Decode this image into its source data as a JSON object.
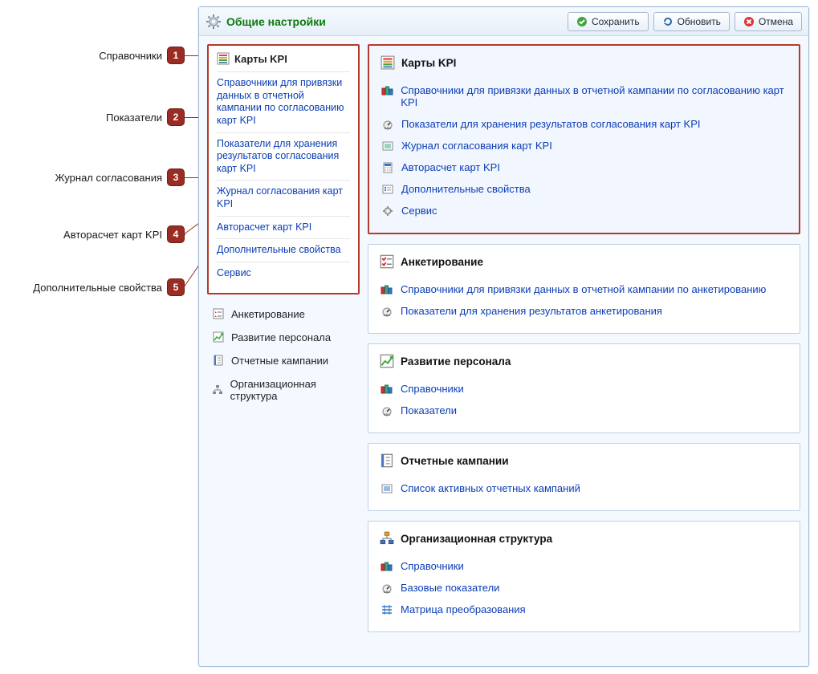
{
  "annotations": [
    {
      "label": "Справочники",
      "num": "1"
    },
    {
      "label": "Показатели",
      "num": "2"
    },
    {
      "label": "Журнал согласования",
      "num": "3"
    },
    {
      "label": "Авторасчет карт KPI",
      "num": "4"
    },
    {
      "label": "Дополнительные свойства",
      "num": "5"
    }
  ],
  "window": {
    "title": "Общие настройки",
    "toolbar": {
      "save": "Сохранить",
      "refresh": "Обновить",
      "cancel": "Отмена"
    }
  },
  "sidebar": {
    "expanded": {
      "title": "Карты KPI",
      "links": [
        "Справочники для привязки данных в отчетной кампании по согласованию карт KPI",
        "Показатели для хранения результатов согласования карт KPI",
        "Журнал согласования карт KPI",
        "Авторасчет карт KPI",
        "Дополнительные свойства",
        "Сервис"
      ]
    },
    "items": [
      "Анкетирование",
      "Развитие персонала",
      "Отчетные кампании",
      "Организационная структура"
    ]
  },
  "main": {
    "sections": [
      {
        "title": "Карты KPI",
        "highlighted": true,
        "items": [
          {
            "icon": "books",
            "label": "Справочники для привязки данных в отчетной кампании по согласованию карт KPI"
          },
          {
            "icon": "gauge",
            "label": "Показатели для хранения результатов согласования карт KPI"
          },
          {
            "icon": "journal",
            "label": "Журнал согласования карт KPI"
          },
          {
            "icon": "calc",
            "label": "Авторасчет карт KPI"
          },
          {
            "icon": "props",
            "label": "Дополнительные свойства"
          },
          {
            "icon": "gear",
            "label": "Сервис"
          }
        ]
      },
      {
        "title": "Анкетирование",
        "items": [
          {
            "icon": "books",
            "label": "Справочники для привязки данных в отчетной кампании по анкетированию"
          },
          {
            "icon": "gauge",
            "label": "Показатели для хранения результатов анкетирования"
          }
        ]
      },
      {
        "title": "Развитие персонала",
        "items": [
          {
            "icon": "books",
            "label": "Справочники"
          },
          {
            "icon": "gauge",
            "label": "Показатели"
          }
        ]
      },
      {
        "title": "Отчетные кампании",
        "items": [
          {
            "icon": "list",
            "label": "Список активных отчетных кампаний"
          }
        ]
      },
      {
        "title": "Организационная структура",
        "items": [
          {
            "icon": "books",
            "label": "Справочники"
          },
          {
            "icon": "gauge",
            "label": "Базовые показатели"
          },
          {
            "icon": "matrix",
            "label": "Матрица преобразования"
          }
        ]
      }
    ]
  }
}
